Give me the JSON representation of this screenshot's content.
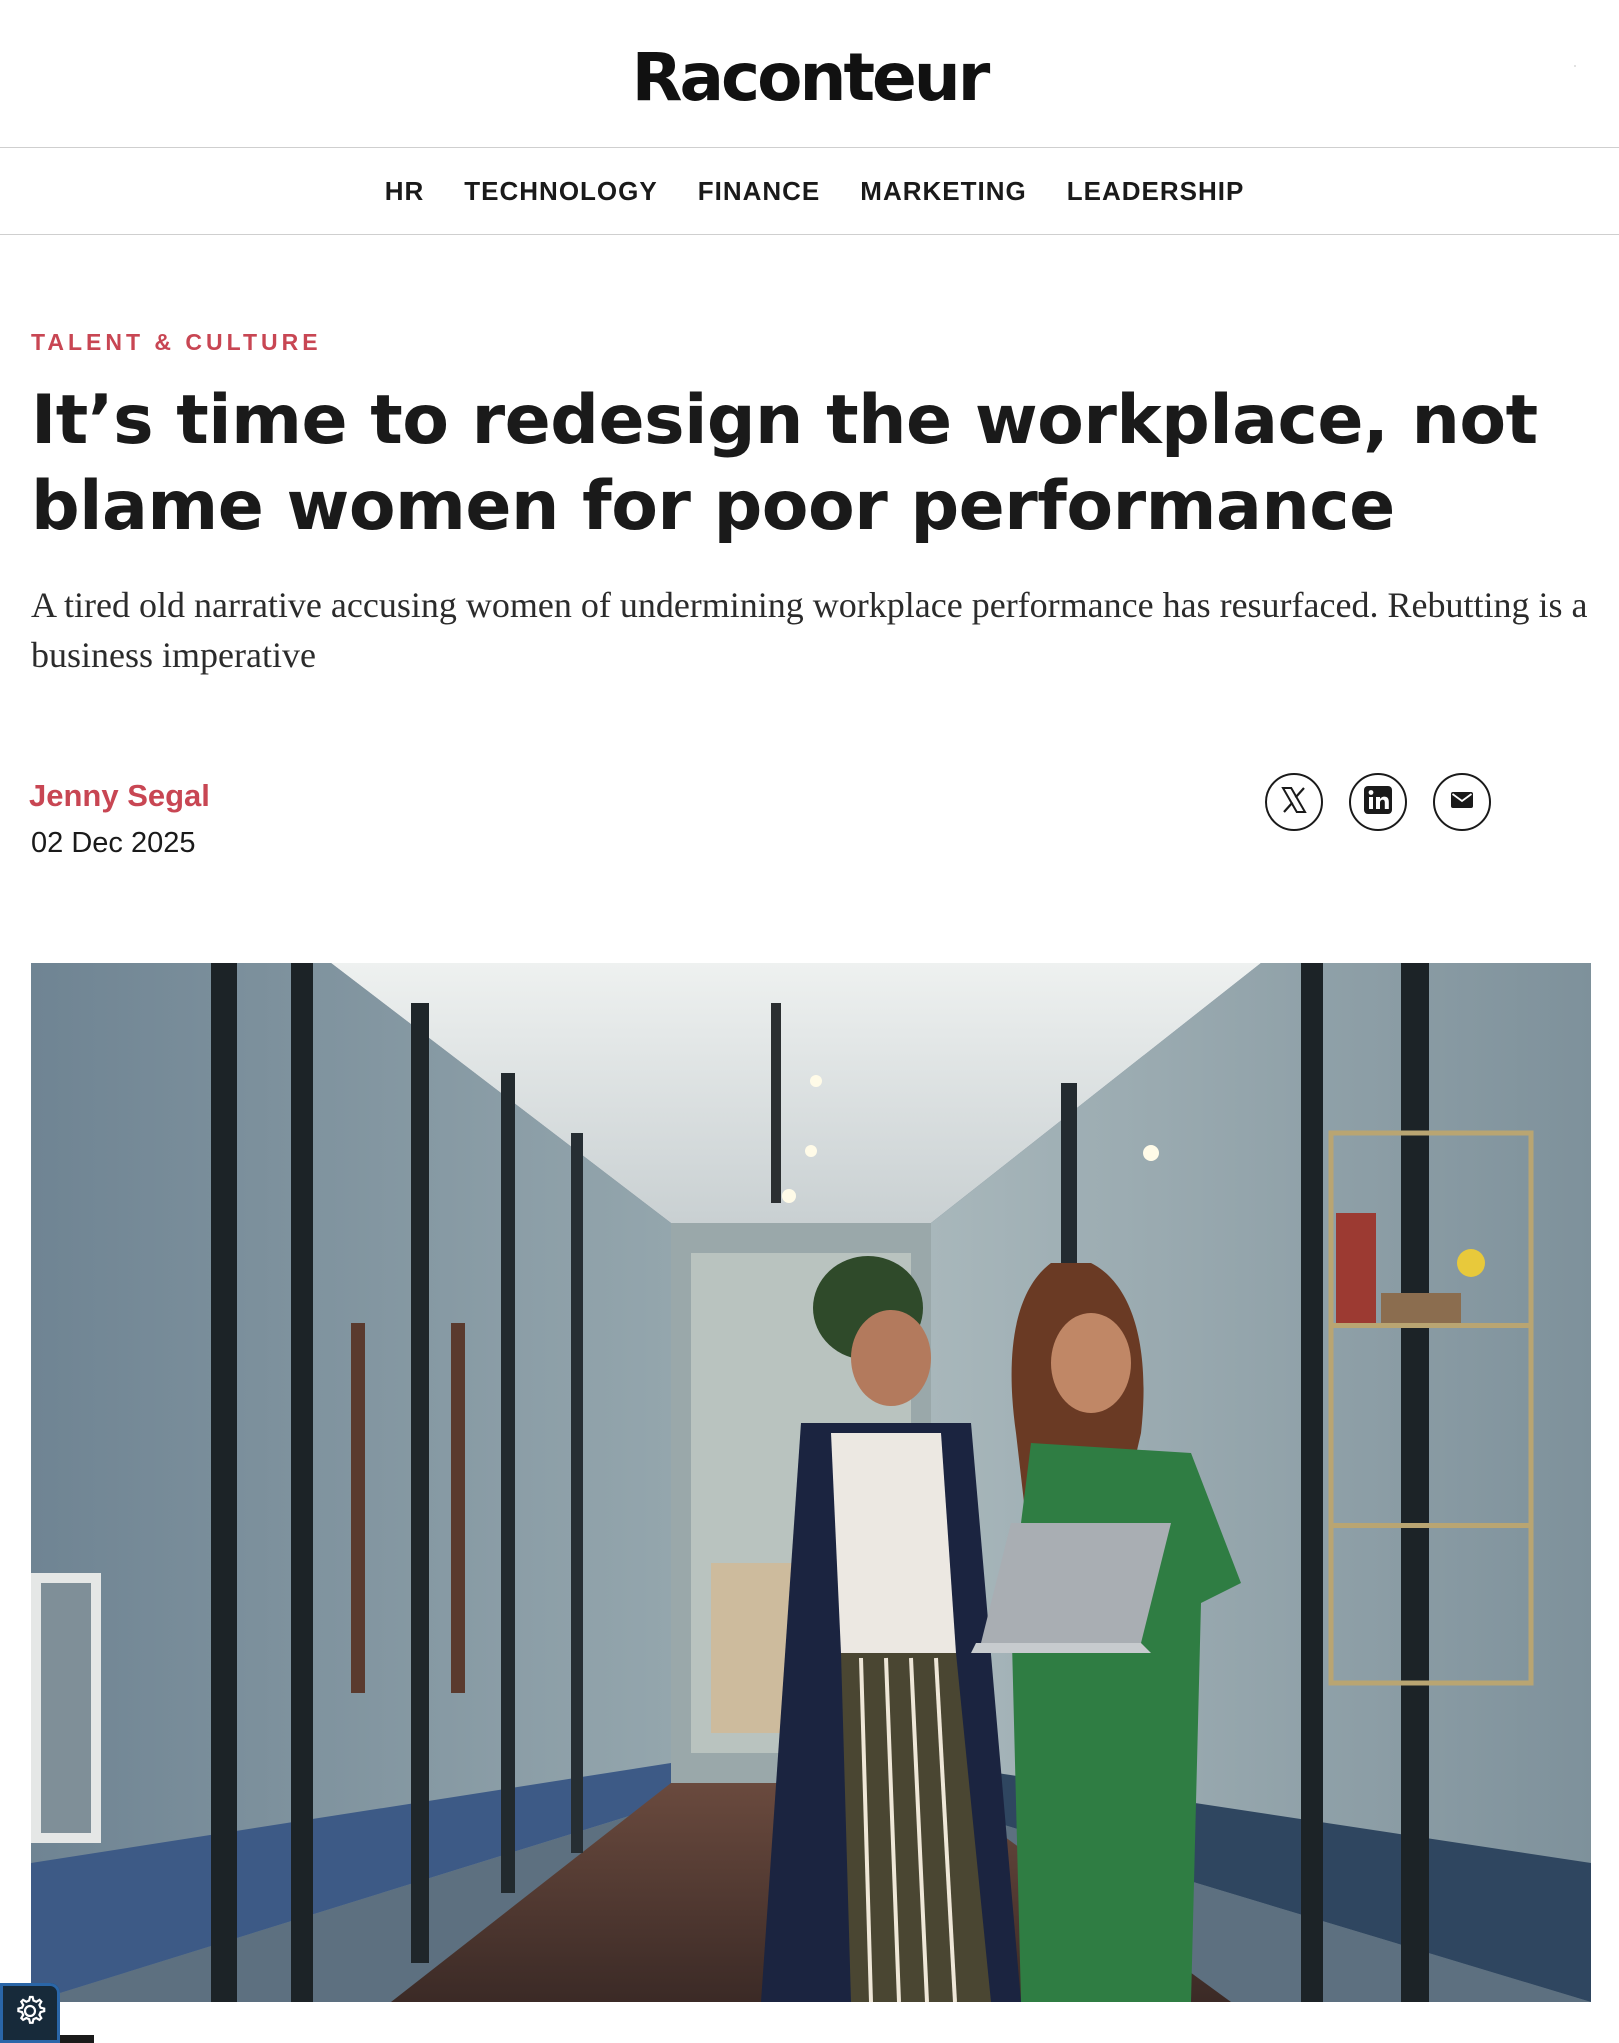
{
  "site": {
    "logo_text": "Raconteur"
  },
  "nav": {
    "items": [
      {
        "label": "HR"
      },
      {
        "label": "TECHNOLOGY"
      },
      {
        "label": "FINANCE"
      },
      {
        "label": "MARKETING"
      },
      {
        "label": "LEADERSHIP"
      }
    ]
  },
  "article": {
    "kicker": "TALENT & CULTURE",
    "headline": "It’s time to redesign the workplace, not blame women for poor performance",
    "standfirst": "A tired old narrative accusing women of undermining workplace performance has resurfaced. Rebutting is a business imperative",
    "author": "Jenny Segal",
    "date": "02 Dec 2025"
  },
  "share": {
    "icons": [
      "x-logo-icon",
      "linkedin-icon",
      "email-icon"
    ]
  },
  "hero_image": {
    "description_icon": "photo-two-women-with-laptop-in-office-corridor"
  },
  "cookie_settings": {
    "icon": "gear-icon"
  },
  "colors": {
    "accent": "#c84653",
    "text": "#1a1a1a",
    "divider": "#cfcfcf",
    "cookie_bg": "#172a3a"
  }
}
